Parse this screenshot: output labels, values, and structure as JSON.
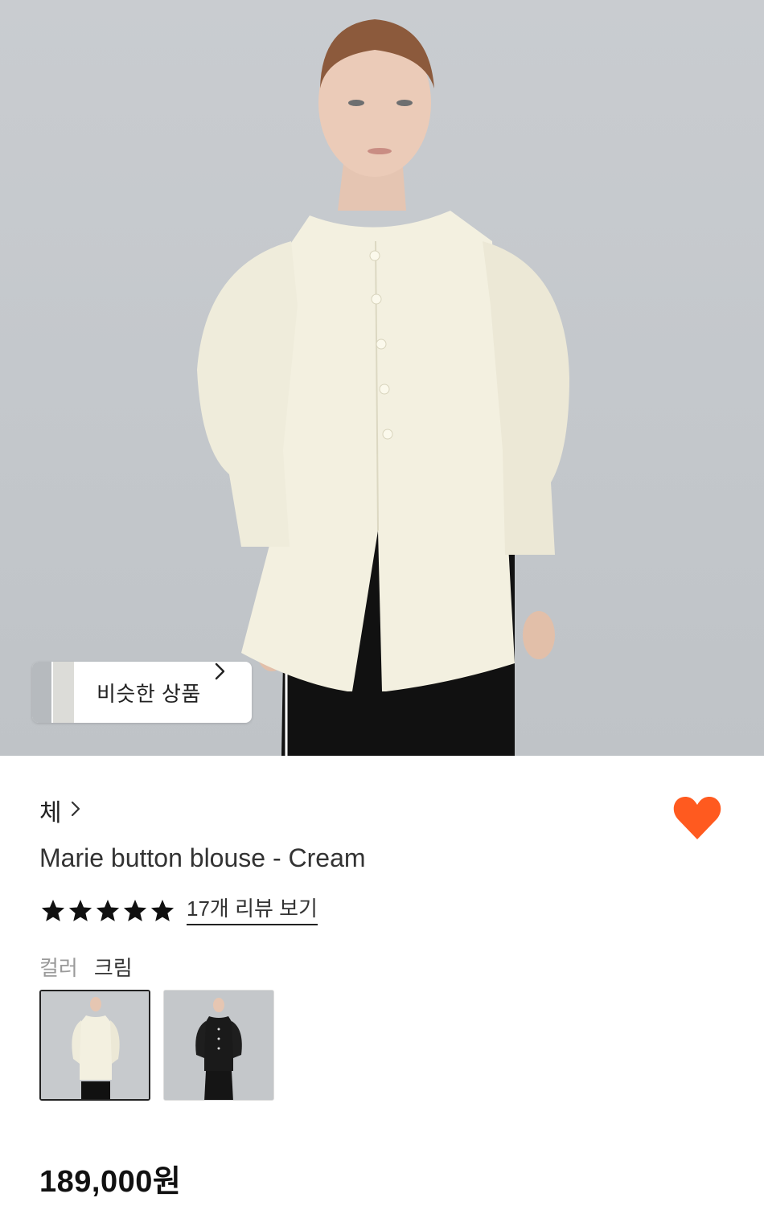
{
  "hero": {
    "image_name": "product-main-photo",
    "similar_products_label": "비슷한 상품"
  },
  "product": {
    "brand": "체",
    "title": "Marie button blouse - Cream",
    "rating_stars": 5,
    "review_link": "17개 리뷰 보기",
    "color_label": "컬러",
    "color_value": "크림",
    "price": "189,000원",
    "liked": true
  },
  "colors": {
    "like_heart": "#ff5a1f",
    "star": "#111111",
    "text_primary": "#222222",
    "text_muted": "#9a9a9a"
  },
  "swatches": [
    {
      "name": "cream",
      "selected": true
    },
    {
      "name": "black",
      "selected": false
    }
  ]
}
